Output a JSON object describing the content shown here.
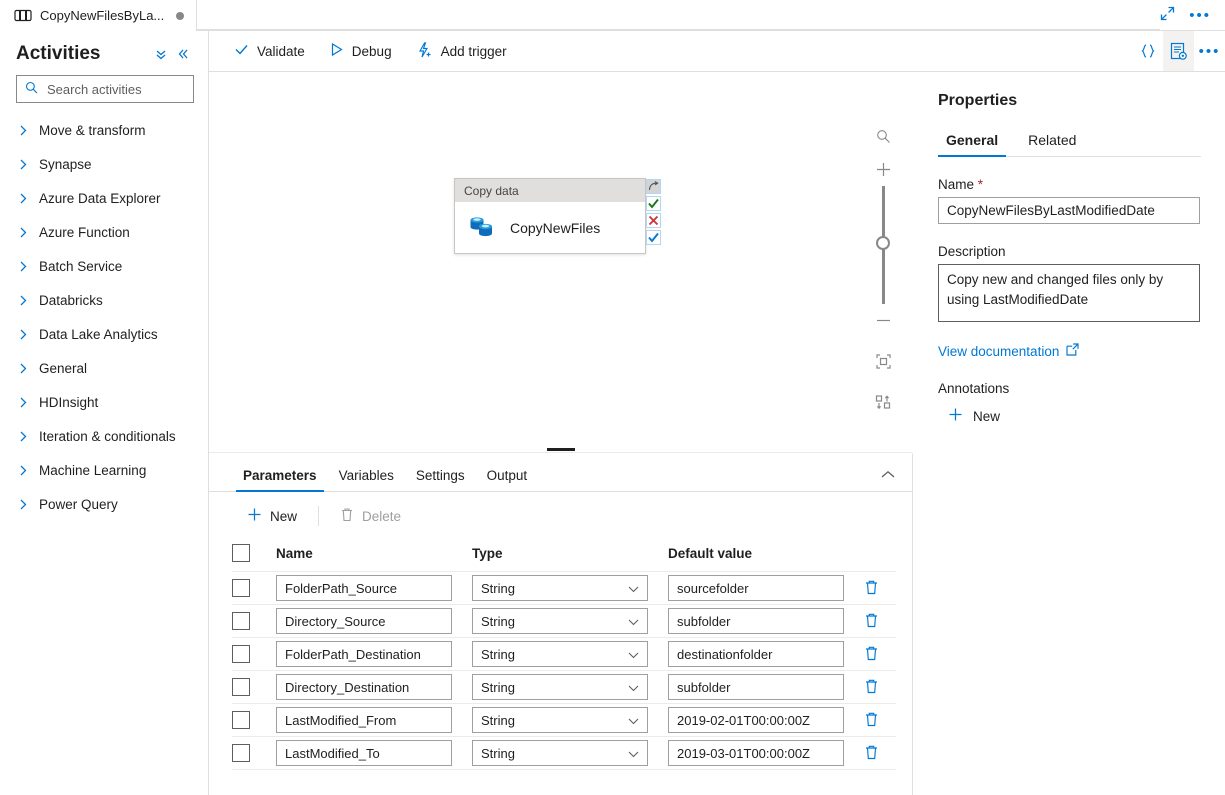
{
  "tabbar": {
    "tab_label": "CopyNewFilesByLa...",
    "tab_icon": "pipeline-icon",
    "expand_icon": "expand-diagonal-icon",
    "more_icon": "more-ellipsis-icon"
  },
  "sidebar": {
    "title": "Activities",
    "collapse_all_icon": "double-chevron-down-icon",
    "collapse_panel_icon": "double-chevron-left-icon",
    "search": {
      "placeholder": "Search activities",
      "value": "",
      "icon": "search-icon"
    },
    "items": [
      {
        "label": "Move & transform"
      },
      {
        "label": "Synapse"
      },
      {
        "label": "Azure Data Explorer"
      },
      {
        "label": "Azure Function"
      },
      {
        "label": "Batch Service"
      },
      {
        "label": "Databricks"
      },
      {
        "label": "Data Lake Analytics"
      },
      {
        "label": "General"
      },
      {
        "label": "HDInsight"
      },
      {
        "label": "Iteration & conditionals"
      },
      {
        "label": "Machine Learning"
      },
      {
        "label": "Power Query"
      }
    ]
  },
  "commandbar": {
    "validate": "Validate",
    "debug": "Debug",
    "add_trigger": "Add trigger",
    "validate_icon": "checkmark-icon",
    "debug_icon": "play-triangle-icon",
    "trigger_icon": "lightning-add-icon",
    "code_icon": "curly-braces-icon",
    "properties_icon": "properties-pane-icon",
    "more_icon": "more-ellipsis-icon"
  },
  "canvas": {
    "node": {
      "header": "Copy data",
      "name": "CopyNewFiles",
      "icon": "copy-data-icon",
      "ports": [
        {
          "name": "skipped-port",
          "glyph": "curve-arrow-icon"
        },
        {
          "name": "success-port",
          "glyph": "green-check-icon"
        },
        {
          "name": "failure-port",
          "glyph": "red-x-icon"
        },
        {
          "name": "completion-port",
          "glyph": "blue-check-icon"
        }
      ]
    },
    "controls": [
      {
        "name": "zoom-search-icon"
      },
      {
        "name": "zoom-in-icon"
      },
      {
        "name": "zoom-slider"
      },
      {
        "name": "zoom-out-icon"
      },
      {
        "name": "zoom-to-fit-icon"
      },
      {
        "name": "auto-layout-icon"
      }
    ]
  },
  "bottom_panel": {
    "tabs": [
      {
        "label": "Parameters",
        "selected": true
      },
      {
        "label": "Variables",
        "selected": false
      },
      {
        "label": "Settings",
        "selected": false
      },
      {
        "label": "Output",
        "selected": false
      }
    ],
    "collapse_icon": "chevron-up-icon",
    "toolbar": {
      "new_label": "New",
      "new_icon": "plus-icon",
      "delete_label": "Delete",
      "delete_icon": "trash-icon",
      "delete_disabled": true
    },
    "table": {
      "headers": [
        "Name",
        "Type",
        "Default value"
      ],
      "rows": [
        {
          "name": "FolderPath_Source",
          "type": "String",
          "default": "sourcefolder"
        },
        {
          "name": "Directory_Source",
          "type": "String",
          "default": "subfolder"
        },
        {
          "name": "FolderPath_Destination",
          "type": "String",
          "default": "destinationfolder"
        },
        {
          "name": "Directory_Destination",
          "type": "String",
          "default": "subfolder"
        },
        {
          "name": "LastModified_From",
          "type": "String",
          "default": "2019-02-01T00:00:00Z"
        },
        {
          "name": "LastModified_To",
          "type": "String",
          "default": "2019-03-01T00:00:00Z"
        }
      ],
      "row_delete_icon": "trash-icon",
      "type_dropdown_icon": "chevron-down-icon"
    }
  },
  "properties": {
    "title": "Properties",
    "tabs": [
      {
        "label": "General",
        "selected": true
      },
      {
        "label": "Related",
        "selected": false
      }
    ],
    "name_label": "Name",
    "name_required": "*",
    "name_value": "CopyNewFilesByLastModifiedDate",
    "description_label": "Description",
    "description_value": "Copy new and changed files only by using LastModifiedDate",
    "view_documentation": "View documentation",
    "view_documentation_icon": "external-link-icon",
    "annotations_label": "Annotations",
    "annotation_new": "New",
    "annotation_new_icon": "plus-icon"
  },
  "colors": {
    "accent": "#0078d4",
    "border": "#e1dfdd",
    "text": "#201f1e",
    "success": "#107c10",
    "error": "#d13438",
    "node_header": "#e1dfdd"
  }
}
